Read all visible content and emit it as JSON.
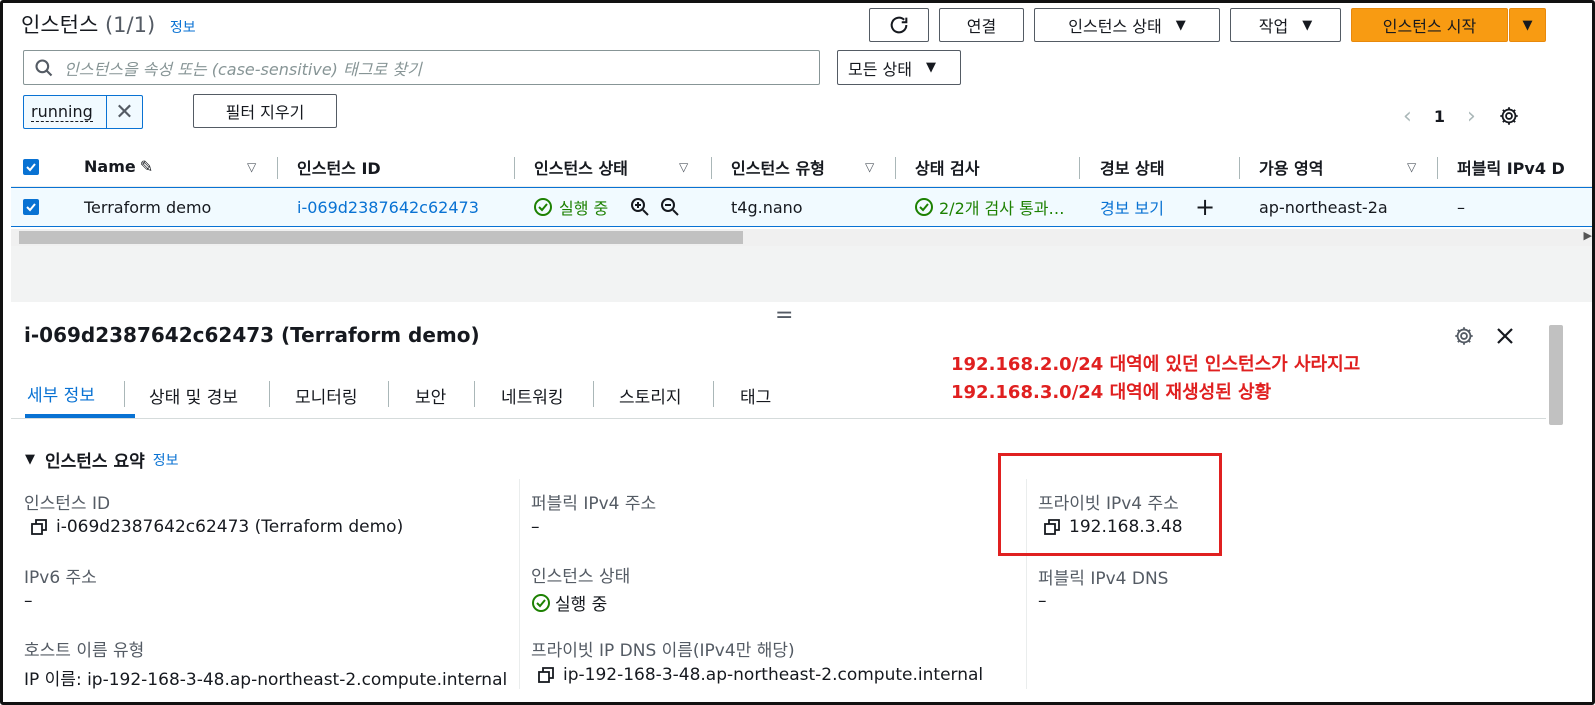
{
  "header": {
    "title": "인스턴스",
    "count": "(1/1)",
    "info": "정보",
    "buttons": {
      "connect": "연결",
      "instance_state": "인스턴스 상태",
      "actions": "작업",
      "launch": "인스턴스 시작"
    }
  },
  "search": {
    "placeholder": "인스턴스을 속성 또는 (case-sensitive) 태그로 찾기"
  },
  "state_filter": "모든 상태",
  "filter_token": "running",
  "clear_filters": "필터 지우기",
  "pagination": {
    "page": "1"
  },
  "table": {
    "columns": [
      "Name",
      "인스턴스 ID",
      "인스턴스 상태",
      "인스턴스 유형",
      "상태 검사",
      "경보 상태",
      "가용 영역",
      "퍼블릭 IPv4 D"
    ],
    "row": {
      "name": "Terraform demo",
      "instance_id": "i-069d2387642c62473",
      "state": "실행 중",
      "type": "t4g.nano",
      "status_check": "2/2개 검사 통과…",
      "alarm": "경보 보기",
      "az": "ap-northeast-2a",
      "public_ipv4": "–"
    }
  },
  "detail": {
    "title": "i-069d2387642c62473 (Terraform demo)",
    "tabs": [
      "세부 정보",
      "상태 및 경보",
      "모니터링",
      "보안",
      "네트워킹",
      "스토리지",
      "태그"
    ],
    "section": "인스턴스 요약",
    "section_info": "정보",
    "fields": {
      "instance_id_label": "인스턴스 ID",
      "instance_id_value": "i-069d2387642c62473 (Terraform demo)",
      "public_ipv4_label": "퍼블릭 IPv4 주소",
      "public_ipv4_value": "–",
      "private_ipv4_label": "프라이빗 IPv4 주소",
      "private_ipv4_value": "192.168.3.48",
      "ipv6_label": "IPv6 주소",
      "ipv6_value": "–",
      "state_label": "인스턴스 상태",
      "state_value": "실행 중",
      "public_dns_label": "퍼블릭 IPv4 DNS",
      "public_dns_value": "–",
      "hostname_type_label": "호스트 이름 유형",
      "hostname_type_value": "IP 이름: ip-192-168-3-48.ap-northeast-2.compute.internal",
      "private_dns_label": "프라이빗 IP DNS 이름(IPv4만 해당)",
      "private_dns_value": "ip-192-168-3-48.ap-northeast-2.compute.internal"
    }
  },
  "annotation": {
    "line1": "192.168.2.0/24 대역에 있던 인스턴스가 사라지고",
    "line2": "192.168.3.0/24 대역에 재생성된 상황"
  },
  "colors": {
    "accent": "#0972d3",
    "orange": "#f89b12",
    "success": "#1d8102",
    "annotation": "#e02020"
  }
}
